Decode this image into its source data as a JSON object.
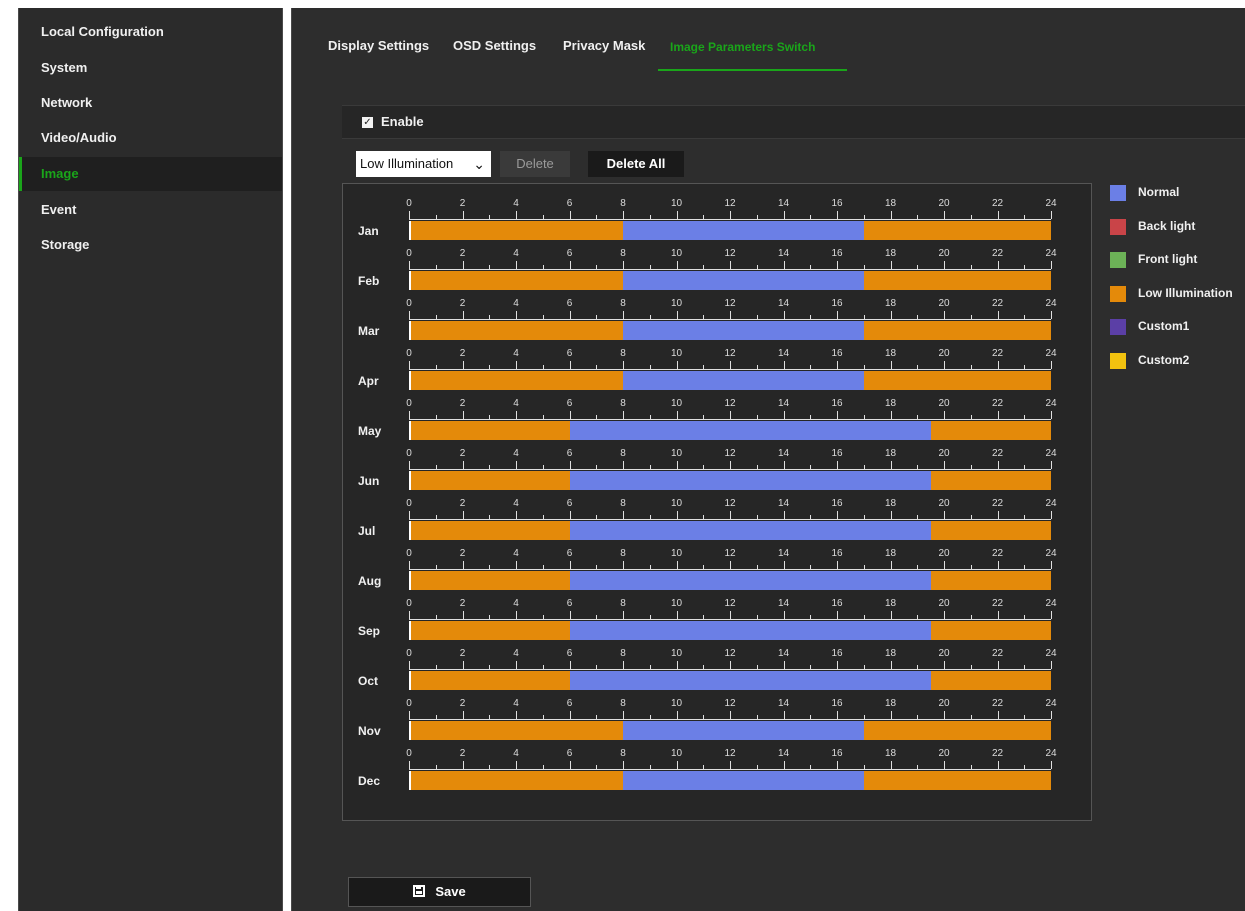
{
  "sidebar": {
    "items": [
      {
        "label": "Local Configuration",
        "active": false
      },
      {
        "label": "System",
        "active": false
      },
      {
        "label": "Network",
        "active": false
      },
      {
        "label": "Video/Audio",
        "active": false
      },
      {
        "label": "Image",
        "active": true
      },
      {
        "label": "Event",
        "active": false
      },
      {
        "label": "Storage",
        "active": false
      }
    ]
  },
  "tabs": [
    {
      "label": "Display Settings",
      "active": false
    },
    {
      "label": "OSD Settings",
      "active": false
    },
    {
      "label": "Privacy Mask",
      "active": false
    },
    {
      "label": "Image Parameters Switch",
      "active": true
    }
  ],
  "enable": {
    "label": "Enable",
    "checked": true
  },
  "toolbar": {
    "mode_select": "Low Illumination",
    "delete_label": "Delete",
    "delete_all_label": "Delete All"
  },
  "schedule": {
    "hour_ticks": [
      "0",
      "2",
      "4",
      "6",
      "8",
      "10",
      "12",
      "14",
      "16",
      "18",
      "20",
      "22",
      "24"
    ],
    "months": [
      {
        "label": "Jan",
        "segments": [
          {
            "mode": "Low Illumination",
            "start": 0,
            "end": 8
          },
          {
            "mode": "Normal",
            "start": 8,
            "end": 17
          },
          {
            "mode": "Low Illumination",
            "start": 17,
            "end": 24
          }
        ]
      },
      {
        "label": "Feb",
        "segments": [
          {
            "mode": "Low Illumination",
            "start": 0,
            "end": 8
          },
          {
            "mode": "Normal",
            "start": 8,
            "end": 17
          },
          {
            "mode": "Low Illumination",
            "start": 17,
            "end": 24
          }
        ]
      },
      {
        "label": "Mar",
        "segments": [
          {
            "mode": "Low Illumination",
            "start": 0,
            "end": 8
          },
          {
            "mode": "Normal",
            "start": 8,
            "end": 17
          },
          {
            "mode": "Low Illumination",
            "start": 17,
            "end": 24
          }
        ]
      },
      {
        "label": "Apr",
        "segments": [
          {
            "mode": "Low Illumination",
            "start": 0,
            "end": 8
          },
          {
            "mode": "Normal",
            "start": 8,
            "end": 17
          },
          {
            "mode": "Low Illumination",
            "start": 17,
            "end": 24
          }
        ]
      },
      {
        "label": "May",
        "segments": [
          {
            "mode": "Low Illumination",
            "start": 0,
            "end": 6
          },
          {
            "mode": "Normal",
            "start": 6,
            "end": 19.5
          },
          {
            "mode": "Low Illumination",
            "start": 19.5,
            "end": 24
          }
        ]
      },
      {
        "label": "Jun",
        "segments": [
          {
            "mode": "Low Illumination",
            "start": 0,
            "end": 6
          },
          {
            "mode": "Normal",
            "start": 6,
            "end": 19.5
          },
          {
            "mode": "Low Illumination",
            "start": 19.5,
            "end": 24
          }
        ]
      },
      {
        "label": "Jul",
        "segments": [
          {
            "mode": "Low Illumination",
            "start": 0,
            "end": 6
          },
          {
            "mode": "Normal",
            "start": 6,
            "end": 19.5
          },
          {
            "mode": "Low Illumination",
            "start": 19.5,
            "end": 24
          }
        ]
      },
      {
        "label": "Aug",
        "segments": [
          {
            "mode": "Low Illumination",
            "start": 0,
            "end": 6
          },
          {
            "mode": "Normal",
            "start": 6,
            "end": 19.5
          },
          {
            "mode": "Low Illumination",
            "start": 19.5,
            "end": 24
          }
        ]
      },
      {
        "label": "Sep",
        "segments": [
          {
            "mode": "Low Illumination",
            "start": 0,
            "end": 6
          },
          {
            "mode": "Normal",
            "start": 6,
            "end": 19.5
          },
          {
            "mode": "Low Illumination",
            "start": 19.5,
            "end": 24
          }
        ]
      },
      {
        "label": "Oct",
        "segments": [
          {
            "mode": "Low Illumination",
            "start": 0,
            "end": 6
          },
          {
            "mode": "Normal",
            "start": 6,
            "end": 19.5
          },
          {
            "mode": "Low Illumination",
            "start": 19.5,
            "end": 24
          }
        ]
      },
      {
        "label": "Nov",
        "segments": [
          {
            "mode": "Low Illumination",
            "start": 0,
            "end": 8
          },
          {
            "mode": "Normal",
            "start": 8,
            "end": 17
          },
          {
            "mode": "Low Illumination",
            "start": 17,
            "end": 24
          }
        ]
      },
      {
        "label": "Dec",
        "segments": [
          {
            "mode": "Low Illumination",
            "start": 0,
            "end": 8
          },
          {
            "mode": "Normal",
            "start": 8,
            "end": 17
          },
          {
            "mode": "Low Illumination",
            "start": 17,
            "end": 24
          }
        ]
      }
    ]
  },
  "legend": [
    {
      "label": "Normal",
      "color": "#6b7fe6"
    },
    {
      "label": "Back light",
      "color": "#c94448"
    },
    {
      "label": "Front light",
      "color": "#6cb257"
    },
    {
      "label": "Low Illumination",
      "color": "#e48a0a"
    },
    {
      "label": "Custom1",
      "color": "#5b3fa6"
    },
    {
      "label": "Custom2",
      "color": "#f2c20f"
    }
  ],
  "save": {
    "label": "Save"
  },
  "colors": {
    "accent": "#1aa51a"
  }
}
